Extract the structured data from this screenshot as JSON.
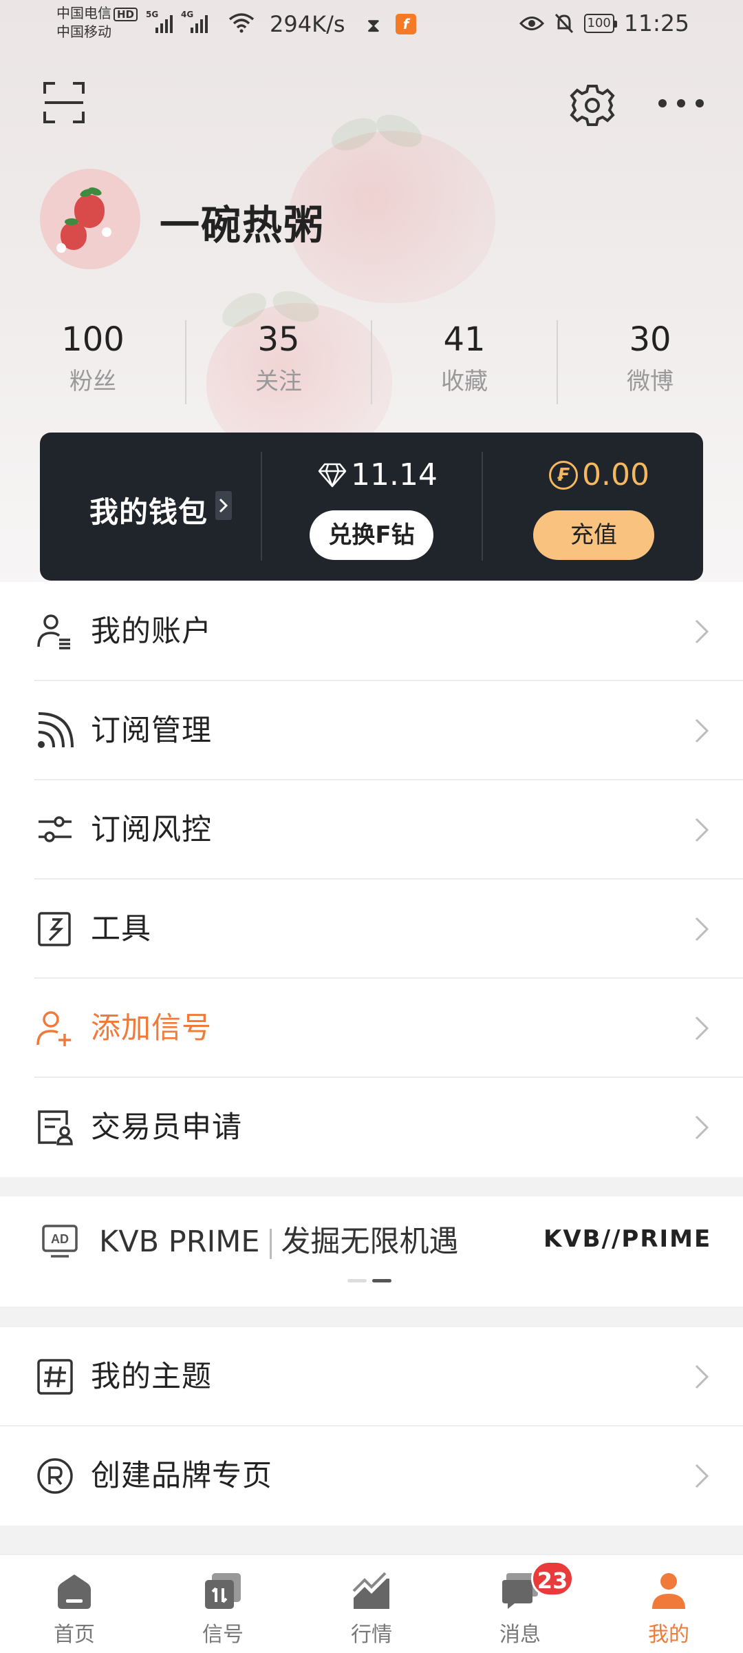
{
  "status_bar": {
    "carrier1": "中国电信",
    "carrier1_badge": "HD",
    "carrier2": "中国移动",
    "signal1_tag": "5G",
    "signal2_tag": "4G",
    "net_speed": "294K/s",
    "battery": "100",
    "time": "11:25"
  },
  "profile": {
    "username": "一碗热粥",
    "stats": [
      {
        "value": "100",
        "label": "粉丝"
      },
      {
        "value": "35",
        "label": "关注"
      },
      {
        "value": "41",
        "label": "收藏"
      },
      {
        "value": "30",
        "label": "微博"
      }
    ]
  },
  "wallet": {
    "title": "我的钱包",
    "diamond_value": "11.14",
    "exchange_label": "兑换F钻",
    "coin_glyph": "₣",
    "coin_value": "0.00",
    "recharge_label": "充值"
  },
  "menu": [
    {
      "label": "我的账户",
      "icon": "account-icon"
    },
    {
      "label": "订阅管理",
      "icon": "subscription-icon"
    },
    {
      "label": "订阅风控",
      "icon": "risk-control-icon"
    },
    {
      "label": "工具",
      "icon": "tools-icon"
    },
    {
      "label": "添加信号",
      "icon": "add-signal-icon",
      "accent": true
    },
    {
      "label": "交易员申请",
      "icon": "trader-application-icon"
    }
  ],
  "ad": {
    "icon_text": "AD",
    "brand": "KVB PRIME",
    "tagline": "发掘无限机遇",
    "logo": "KVB//PRIME"
  },
  "menu2": [
    {
      "label": "我的主题",
      "icon": "hashtag-icon"
    },
    {
      "label": "创建品牌专页",
      "icon": "registered-brand-icon"
    }
  ],
  "bottom_nav": [
    {
      "label": "首页",
      "icon": "home-icon"
    },
    {
      "label": "信号",
      "icon": "signal-icon"
    },
    {
      "label": "行情",
      "icon": "market-icon"
    },
    {
      "label": "消息",
      "icon": "message-icon",
      "badge": "23"
    },
    {
      "label": "我的",
      "icon": "profile-icon",
      "active": true
    }
  ],
  "colors": {
    "accent": "#f07a3a",
    "wallet_bg": "#20252c",
    "coin_gold": "#f4b95f",
    "recharge_btn": "#f9c37f",
    "badge_red": "#e93b3b"
  }
}
